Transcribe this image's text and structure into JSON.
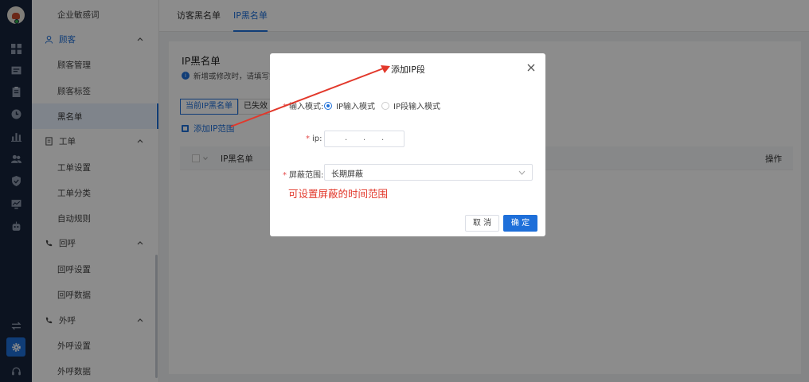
{
  "colors": {
    "accent": "#1e6fd9",
    "rail": "#16243b",
    "annotation": "#e2382b"
  },
  "rail_icons": [
    "dashboard-icon",
    "inbox-icon",
    "clipboard-icon",
    "history-icon",
    "chart-icon",
    "contacts-icon",
    "shield-icon",
    "monitor-icon",
    "robot-icon",
    "transfer-icon",
    "settings-icon",
    "headset-icon"
  ],
  "sidebar": {
    "items": [
      {
        "label": "企业敏感词",
        "type": "sub"
      },
      {
        "label": "顾客",
        "type": "group",
        "icon": "user-icon"
      },
      {
        "label": "顾客管理",
        "type": "sub"
      },
      {
        "label": "顾客标签",
        "type": "sub"
      },
      {
        "label": "黑名单",
        "type": "sub",
        "selected": true
      },
      {
        "label": "工单",
        "type": "group",
        "icon": "ticket-icon"
      },
      {
        "label": "工单设置",
        "type": "sub"
      },
      {
        "label": "工单分类",
        "type": "sub"
      },
      {
        "label": "自动规则",
        "type": "sub"
      },
      {
        "label": "回呼",
        "type": "group",
        "icon": "callback-icon"
      },
      {
        "label": "回呼设置",
        "type": "sub"
      },
      {
        "label": "回呼数据",
        "type": "sub"
      },
      {
        "label": "外呼",
        "type": "group",
        "icon": "outbound-call-icon"
      },
      {
        "label": "外呼设置",
        "type": "sub"
      },
      {
        "label": "外呼数据",
        "type": "sub"
      }
    ]
  },
  "tabs": [
    {
      "label": "访客黑名单",
      "active": false
    },
    {
      "label": "IP黑名单",
      "active": true
    }
  ],
  "panel": {
    "title": "IP黑名单",
    "info": "新增或修改时，请填写完",
    "subtabs": [
      "当前IP黑名单",
      "已失效"
    ],
    "add_label": "添加IP范围",
    "columns": [
      "IP黑名单",
      "操作"
    ]
  },
  "modal": {
    "title": "添加IP段",
    "mode_label": "输入模式:",
    "modes": [
      {
        "label": "IP输入模式",
        "selected": true
      },
      {
        "label": "IP段输入模式",
        "selected": false
      }
    ],
    "ip_label": "ip:",
    "ip_separator": ".",
    "scope_label": "屏蔽范围:",
    "scope_value": "长期屏蔽",
    "note": "可设置屏蔽的时间范围",
    "cancel_label": "取 消",
    "ok_label": "确 定",
    "required_mark": "*"
  }
}
